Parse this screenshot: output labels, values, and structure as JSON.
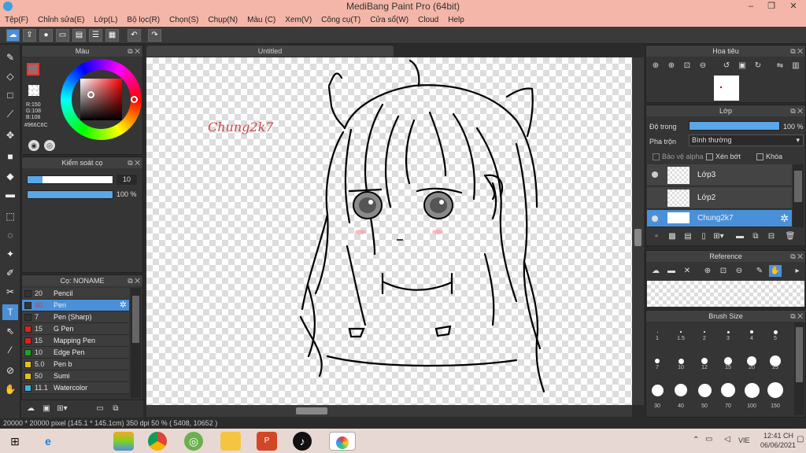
{
  "window": {
    "title": "MediBang Paint Pro (64bit)",
    "minimize": "–",
    "maximize": "❐",
    "close": "✕"
  },
  "menu": [
    "Tệp(F)",
    "Chỉnh sửa(E)",
    "Lớp(L)",
    "Bộ lọc(R)",
    "Chọn(S)",
    "Chụp(N)",
    "Màu (C)",
    "Xem(V)",
    "Công cụ(T)",
    "Cửa sổ(W)",
    "Cloud",
    "Help"
  ],
  "toolbar": {
    "undo_icon": "undo-icon",
    "redo_icon": "redo-icon"
  },
  "color_panel": {
    "title": "Màu",
    "r": "R:150",
    "g": "G:108",
    "b": "B:108",
    "hex": "#966C6C",
    "primary_color": "#966c6c"
  },
  "brush_control": {
    "title": "Kiểm soát cọ",
    "size": "10",
    "opacity": "100 %"
  },
  "brush_panel": {
    "title": "Cọ: NONAME",
    "brushes": [
      {
        "size": "20",
        "name": "Pencil",
        "color": "#333333"
      },
      {
        "size": "40",
        "name": "Pen",
        "color": "#333333"
      },
      {
        "size": "7",
        "name": "Pen (Sharp)",
        "color": "#333333"
      },
      {
        "size": "15",
        "name": "G Pen",
        "color": "#e02020"
      },
      {
        "size": "15",
        "name": "Mapping Pen",
        "color": "#e02020"
      },
      {
        "size": "10",
        "name": "Edge Pen",
        "color": "#20a020"
      },
      {
        "size": "5.0",
        "name": "Pen b",
        "color": "#e0c020"
      },
      {
        "size": "50",
        "name": "Sumi",
        "color": "#e0c020"
      },
      {
        "size": "11.1",
        "name": "Watercolor",
        "color": "#40b0e0"
      }
    ]
  },
  "canvas": {
    "tab": "Untitled",
    "signature": "Chung2k7"
  },
  "navigator": {
    "title": "Hoa tiêu"
  },
  "layer_panel": {
    "title": "Lớp",
    "opacity_label": "Độ trong",
    "opacity_value": "100 %",
    "blend_label": "Pha trộn",
    "blend_value": "Bình thường",
    "protect_alpha": "Bảo vệ alpha",
    "clipping": "Xén bớt",
    "lock": "Khóa",
    "layers": [
      "Lớp3",
      "Lớp2",
      "Chung2k7"
    ]
  },
  "reference": {
    "title": "Reference"
  },
  "brush_size": {
    "title": "Brush Size",
    "sizes": [
      "1",
      "1.5",
      "2",
      "3",
      "4",
      "5",
      "7",
      "10",
      "12",
      "15",
      "20",
      "25",
      "30",
      "40",
      "50",
      "70",
      "100",
      "150"
    ]
  },
  "status": {
    "text": "20000 * 20000 pixel  (145.1 * 145.1cm)  350 dpi  50 %  ( 5408, 10652 )"
  },
  "taskbar": {
    "time": "12:41 CH",
    "date": "06/06/2021",
    "lang": "VIE"
  }
}
